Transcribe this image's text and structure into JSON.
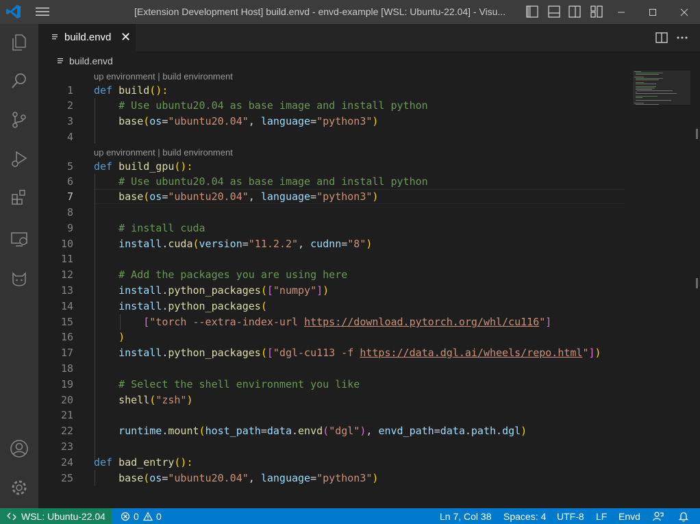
{
  "window": {
    "title": "[Extension Development Host] build.envd - envd-example [WSL: Ubuntu-22.04] - Visu..."
  },
  "tab": {
    "label": "build.envd",
    "close_glyph": "✕"
  },
  "breadcrumb": {
    "file": "build.envd"
  },
  "codelens": {
    "text": "up environment | build environment"
  },
  "line_numbers": [
    "1",
    "2",
    "3",
    "4",
    "5",
    "6",
    "7",
    "8",
    "9",
    "10",
    "11",
    "12",
    "13",
    "14",
    "15",
    "16",
    "17",
    "18",
    "19",
    "20",
    "21",
    "22",
    "23",
    "24",
    "25"
  ],
  "code": {
    "l1": {
      "kw": "def",
      "fn": "build",
      "p1": "():"
    },
    "l2": "# Use ubuntu20.04 as base image and install python",
    "l3": {
      "fn": "base",
      "p1": "(",
      "param1": "os",
      "eq1": "=",
      "s1": "\"ubuntu20.04\"",
      "c1": ", ",
      "param2": "language",
      "eq2": "=",
      "s2": "\"python3\"",
      "p2": ")"
    },
    "l5": {
      "kw": "def",
      "fn": "build_gpu",
      "p1": "():"
    },
    "l6": "# Use ubuntu20.04 as base image and install python",
    "l7": {
      "fn": "base",
      "p1": "(",
      "param1": "os",
      "eq1": "=",
      "s1": "\"ubuntu20.04\"",
      "c1": ", ",
      "param2": "language",
      "eq2": "=",
      "s2": "\"python3\"",
      "p2": ")"
    },
    "l9": "# install cuda",
    "l10": {
      "obj": "install",
      "dot": ".",
      "fn": "cuda",
      "p1": "(",
      "param1": "version",
      "eq1": "=",
      "s1": "\"11.2.2\"",
      "c1": ", ",
      "param2": "cudnn",
      "eq2": "=",
      "s2": "\"8\"",
      "p2": ")"
    },
    "l12": "# Add the packages you are using here",
    "l13": {
      "obj": "install",
      "dot": ".",
      "fn": "python_packages",
      "p1": "(",
      "b1": "[",
      "s1": "\"numpy\"",
      "b2": "]",
      "p2": ")"
    },
    "l14": {
      "obj": "install",
      "dot": ".",
      "fn": "python_packages",
      "p1": "("
    },
    "l15": {
      "b1": "[",
      "s1a": "\"torch --extra-index-url ",
      "s1link": "https://download.pytorch.org/whl/cu116",
      "s1b": "\"",
      "b2": "]"
    },
    "l16": ")",
    "l17": {
      "obj": "install",
      "dot": ".",
      "fn": "python_packages",
      "p1": "(",
      "b1": "[",
      "s1a": "\"dgl-cu113 -f ",
      "s1link": "https://data.dgl.ai/wheels/repo.html",
      "s1b": "\"",
      "b2": "]",
      "p2": ")"
    },
    "l19": "# Select the shell environment you like",
    "l20": {
      "fn": "shell",
      "p1": "(",
      "s1": "\"zsh\"",
      "p2": ")"
    },
    "l22": {
      "obj": "runtime",
      "dot": ".",
      "fn": "mount",
      "p1": "(",
      "param1": "host_path",
      "eq1": "=",
      "v1": "data",
      "d1": ".",
      "v1b": "envd",
      "b1": "(",
      "s1": "\"dgl\"",
      "b2": ")",
      "c1": ", ",
      "param2": "envd_path",
      "eq2": "=",
      "v2": "data",
      "d2": ".",
      "v2b": "path",
      "d3": ".",
      "v2c": "dgl",
      "p2": ")"
    },
    "l24": {
      "kw": "def",
      "fn": "bad_entry",
      "p1": "():"
    },
    "l25": {
      "fn": "base",
      "p1": "(",
      "param1": "os",
      "eq1": "=",
      "s1": "\"ubuntu20.04\"",
      "c1": ", ",
      "param2": "language",
      "eq2": "=",
      "s2": "\"python3\"",
      "p2": ")"
    }
  },
  "status": {
    "remote": "WSL: Ubuntu-22.04",
    "errors": "0",
    "warnings": "0",
    "position": "Ln 7, Col 38",
    "spaces": "Spaces: 4",
    "encoding": "UTF-8",
    "eol": "LF",
    "language": "Envd"
  },
  "colors": {
    "accent": "#007acc",
    "remote": "#16825d",
    "keyword": "#569cd6",
    "function": "#dcdcaa",
    "string": "#ce9178",
    "comment": "#6a9955",
    "parameter": "#9cdcfe"
  },
  "icons": [
    "vscode-logo-icon",
    "menu-icon",
    "toggle-primary-sidebar-icon",
    "toggle-panel-icon",
    "toggle-secondary-sidebar-icon",
    "customize-layout-icon",
    "minimize-icon",
    "maximize-icon",
    "close-icon",
    "explorer-icon",
    "search-icon",
    "source-control-icon",
    "run-debug-icon",
    "extensions-icon",
    "remote-explorer-icon",
    "github-icon",
    "accounts-icon",
    "manage-gear-icon",
    "split-editor-icon",
    "more-actions-icon",
    "remote-icon",
    "error-icon",
    "warning-icon",
    "feedback-icon",
    "notifications-bell-icon"
  ]
}
